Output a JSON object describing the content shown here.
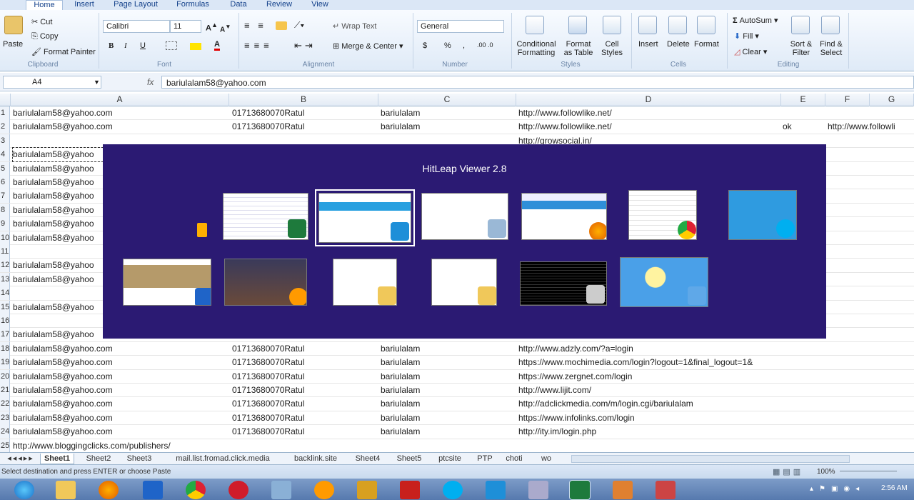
{
  "ribbon_tabs": [
    "Home",
    "Insert",
    "Page Layout",
    "Formulas",
    "Data",
    "Review",
    "View"
  ],
  "clipboard": {
    "paste": "Paste",
    "cut": "Cut",
    "copy": "Copy",
    "format_painter": "Format Painter",
    "group": "Clipboard"
  },
  "font": {
    "name": "Calibri",
    "size": "11",
    "group": "Font",
    "bold": "B",
    "italic": "I",
    "underline": "U"
  },
  "alignment": {
    "wrap_text": "Wrap Text",
    "merge": "Merge & Center",
    "group": "Alignment"
  },
  "number": {
    "format": "General",
    "currency": "$",
    "percent": "%",
    "comma": ",",
    "group": "Number"
  },
  "styles": {
    "conditional": "Conditional Formatting",
    "format_table": "Format as Table",
    "cell_styles": "Cell Styles",
    "group": "Styles"
  },
  "cells": {
    "insert": "Insert",
    "delete": "Delete",
    "format": "Format",
    "group": "Cells"
  },
  "editing": {
    "autosum": "AutoSum",
    "fill": "Fill",
    "clear": "Clear",
    "sort": "Sort & Filter",
    "find": "Find & Select",
    "group": "Editing"
  },
  "formula_bar": {
    "name_box": "A4",
    "fx": "fx",
    "content": "bariulalam58@yahoo.com"
  },
  "columns": [
    "A",
    "B",
    "C",
    "D",
    "E",
    "F",
    "G"
  ],
  "rows": [
    {
      "n": "1",
      "a": "bariulalam58@yahoo.com",
      "b": "01713680070Ratul",
      "c": "bariulalam",
      "d": "http://www.followlike.net/",
      "e": "",
      "f": ""
    },
    {
      "n": "2",
      "a": "bariulalam58@yahoo.com",
      "b": "01713680070Ratul",
      "c": "bariulalam",
      "d": "http://www.followlike.net/",
      "e": "ok",
      "f": "http://www.followli"
    },
    {
      "n": "3",
      "a": "",
      "b": "",
      "c": "",
      "d": "http://growsocial.in/",
      "e": "",
      "f": ""
    },
    {
      "n": "4",
      "a": "bariulalam58@yahoo",
      "b": "",
      "c": "",
      "d": "",
      "e": "",
      "f": ""
    },
    {
      "n": "5",
      "a": "bariulalam58@yahoo",
      "b": "",
      "c": "",
      "d": "",
      "e": "",
      "f": ""
    },
    {
      "n": "6",
      "a": "bariulalam58@yahoo",
      "b": "",
      "c": "",
      "d": "",
      "e": "",
      "f": ""
    },
    {
      "n": "7",
      "a": "bariulalam58@yahoo",
      "b": "",
      "c": "",
      "d": "",
      "e": "",
      "f": ""
    },
    {
      "n": "8",
      "a": "bariulalam58@yahoo",
      "b": "",
      "c": "",
      "d": "",
      "e": "",
      "f": ""
    },
    {
      "n": "9",
      "a": "bariulalam58@yahoo",
      "b": "",
      "c": "",
      "d": "",
      "e": "",
      "f": ""
    },
    {
      "n": "10",
      "a": "bariulalam58@yahoo",
      "b": "",
      "c": "",
      "d": "",
      "e": "",
      "f": ""
    },
    {
      "n": "11",
      "a": "",
      "b": "",
      "c": "",
      "d": "",
      "e": "",
      "f": ""
    },
    {
      "n": "12",
      "a": "bariulalam58@yahoo",
      "b": "",
      "c": "",
      "d": "",
      "e": "",
      "f": ""
    },
    {
      "n": "13",
      "a": "bariulalam58@yahoo",
      "b": "",
      "c": "",
      "d": "",
      "e": "",
      "f": ""
    },
    {
      "n": "14",
      "a": "",
      "b": "",
      "c": "",
      "d": "",
      "e": "",
      "f": ""
    },
    {
      "n": "15",
      "a": "bariulalam58@yahoo",
      "b": "",
      "c": "",
      "d": "",
      "e": "",
      "f": ""
    },
    {
      "n": "16",
      "a": "",
      "b": "",
      "c": "",
      "d": "",
      "e": "",
      "f": ""
    },
    {
      "n": "17",
      "a": "bariulalam58@yahoo",
      "b": "",
      "c": "",
      "d": "",
      "e": "",
      "f": ""
    },
    {
      "n": "18",
      "a": "bariulalam58@yahoo.com",
      "b": "01713680070Ratul",
      "c": "bariulalam",
      "d": "http://www.adzly.com/?a=login",
      "e": "",
      "f": ""
    },
    {
      "n": "19",
      "a": "bariulalam58@yahoo.com",
      "b": "01713680070Ratul",
      "c": "bariulalam",
      "d": "https://www.mochimedia.com/login?logout=1&final_logout=1&",
      "e": "",
      "f": ""
    },
    {
      "n": "20",
      "a": "bariulalam58@yahoo.com",
      "b": "01713680070Ratul",
      "c": "bariulalam",
      "d": "https://www.zergnet.com/login",
      "e": "",
      "f": ""
    },
    {
      "n": "21",
      "a": "bariulalam58@yahoo.com",
      "b": "01713680070Ratul",
      "c": "bariulalam",
      "d": "http://www.lijit.com/",
      "e": "",
      "f": ""
    },
    {
      "n": "22",
      "a": "bariulalam58@yahoo.com",
      "b": "01713680070Ratul",
      "c": "bariulalam",
      "d": "http://adclickmedia.com/m/login.cgi/bariulalam",
      "e": "",
      "f": ""
    },
    {
      "n": "23",
      "a": "bariulalam58@yahoo.com",
      "b": "01713680070Ratul",
      "c": "bariulalam",
      "d": "https://www.infolinks.com/login",
      "e": "",
      "f": ""
    },
    {
      "n": "24",
      "a": "bariulalam58@yahoo.com",
      "b": "01713680070Ratul",
      "c": "bariulalam",
      "d": "http://ity.im/login.php",
      "e": "",
      "f": ""
    },
    {
      "n": "25",
      "a": "http://www.bloggingclicks.com/publishers/",
      "b": "",
      "c": "",
      "d": "",
      "e": "",
      "f": ""
    }
  ],
  "sheet_tabs": [
    "Sheet1",
    "Sheet2",
    "Sheet3",
    "mail.list.fromad.click.media",
    "backlink.site",
    "Sheet4",
    "Sheet5",
    "ptcsite",
    "PTP",
    "choti",
    "wo"
  ],
  "status": {
    "message": "Select destination and press ENTER or choose Paste",
    "zoom": "100%"
  },
  "overlay": {
    "title": "HitLeap Viewer 2.8"
  },
  "clock": {
    "time": "2:56 AM"
  },
  "colors": {
    "overlay_bg": "#2b1a73",
    "ribbon_text": "#15428b",
    "taskbar": "#5679ae"
  }
}
